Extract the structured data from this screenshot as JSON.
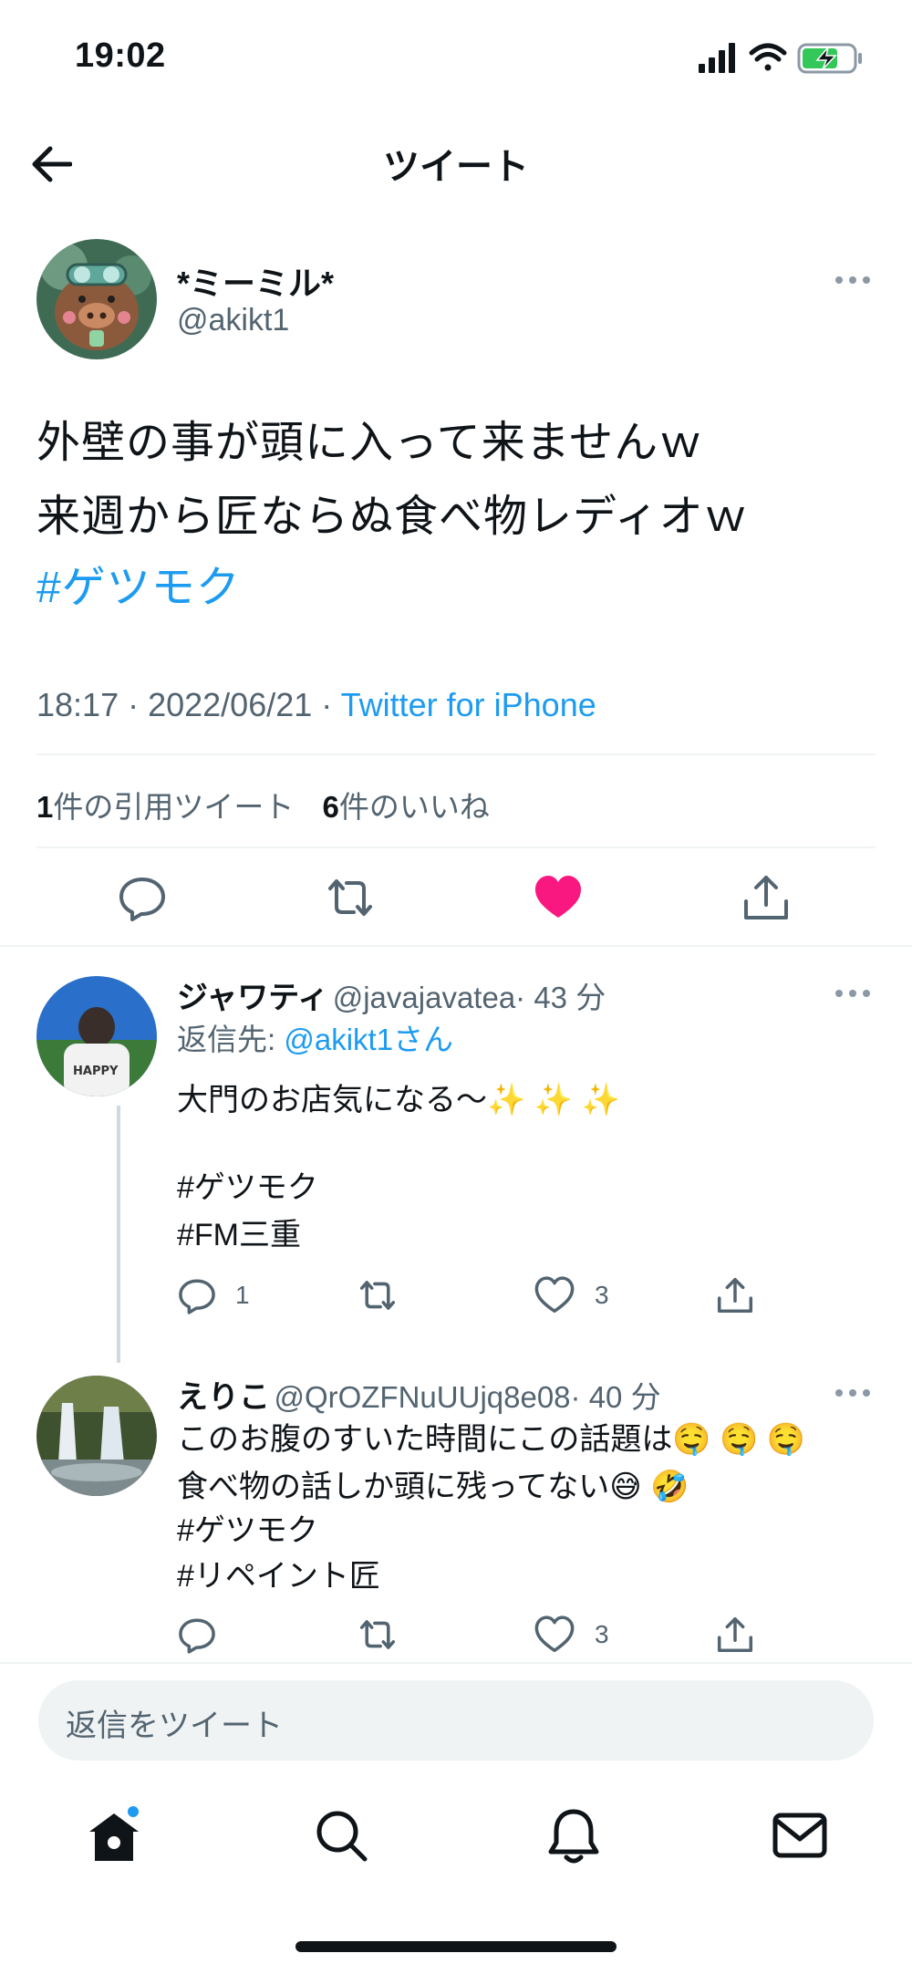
{
  "status_bar": {
    "time": "19:02"
  },
  "header": {
    "title": "ツイート"
  },
  "main_tweet": {
    "display_name": "*ミーミル*",
    "handle": "@akikt1",
    "text_line1": "外壁の事が頭に入って来ませんｗ",
    "text_line2": "来週から匠ならぬ食べ物レディオｗ",
    "hashtag": "#ゲツモク",
    "timestamp": "18:17 · 2022/06/21 · ",
    "source": "Twitter for iPhone",
    "quote_count": "1",
    "quote_label": "件の引用ツイート",
    "like_count": "6",
    "like_label": "件のいいね",
    "colors": {
      "like": "#f91880",
      "link": "#1d9bf0"
    }
  },
  "replies": [
    {
      "display_name": "ジャワティ",
      "handle": "@javajavatea",
      "time": "· 43 分",
      "reply_to_label": "返信先: ",
      "reply_to_handle": "@akikt1さん",
      "text_line1": "大門のお店気になる〜✨ ✨ ✨",
      "hashtag1": "#ゲツモク",
      "hashtag2": "#FM三重",
      "reply_count": "1",
      "like_count": "3"
    },
    {
      "display_name": "えりこ",
      "handle": "@QrOZFNuUUjq8e08",
      "time": "· 40 分",
      "text_line1": "このお腹のすいた時間にこの話題は🤤 🤤 🤤",
      "text_line2": "食べ物の話しか頭に残ってない😅 🤣",
      "hashtag1": "#ゲツモク",
      "hashtag2": "#リペイント匠",
      "like_count": "3"
    }
  ],
  "reply_box": {
    "placeholder": "返信をツイート"
  },
  "icons": [
    "back-arrow-icon",
    "more-icon",
    "reply-icon",
    "retweet-icon",
    "like-icon",
    "share-icon",
    "home-icon",
    "search-icon",
    "notifications-icon",
    "messages-icon"
  ]
}
